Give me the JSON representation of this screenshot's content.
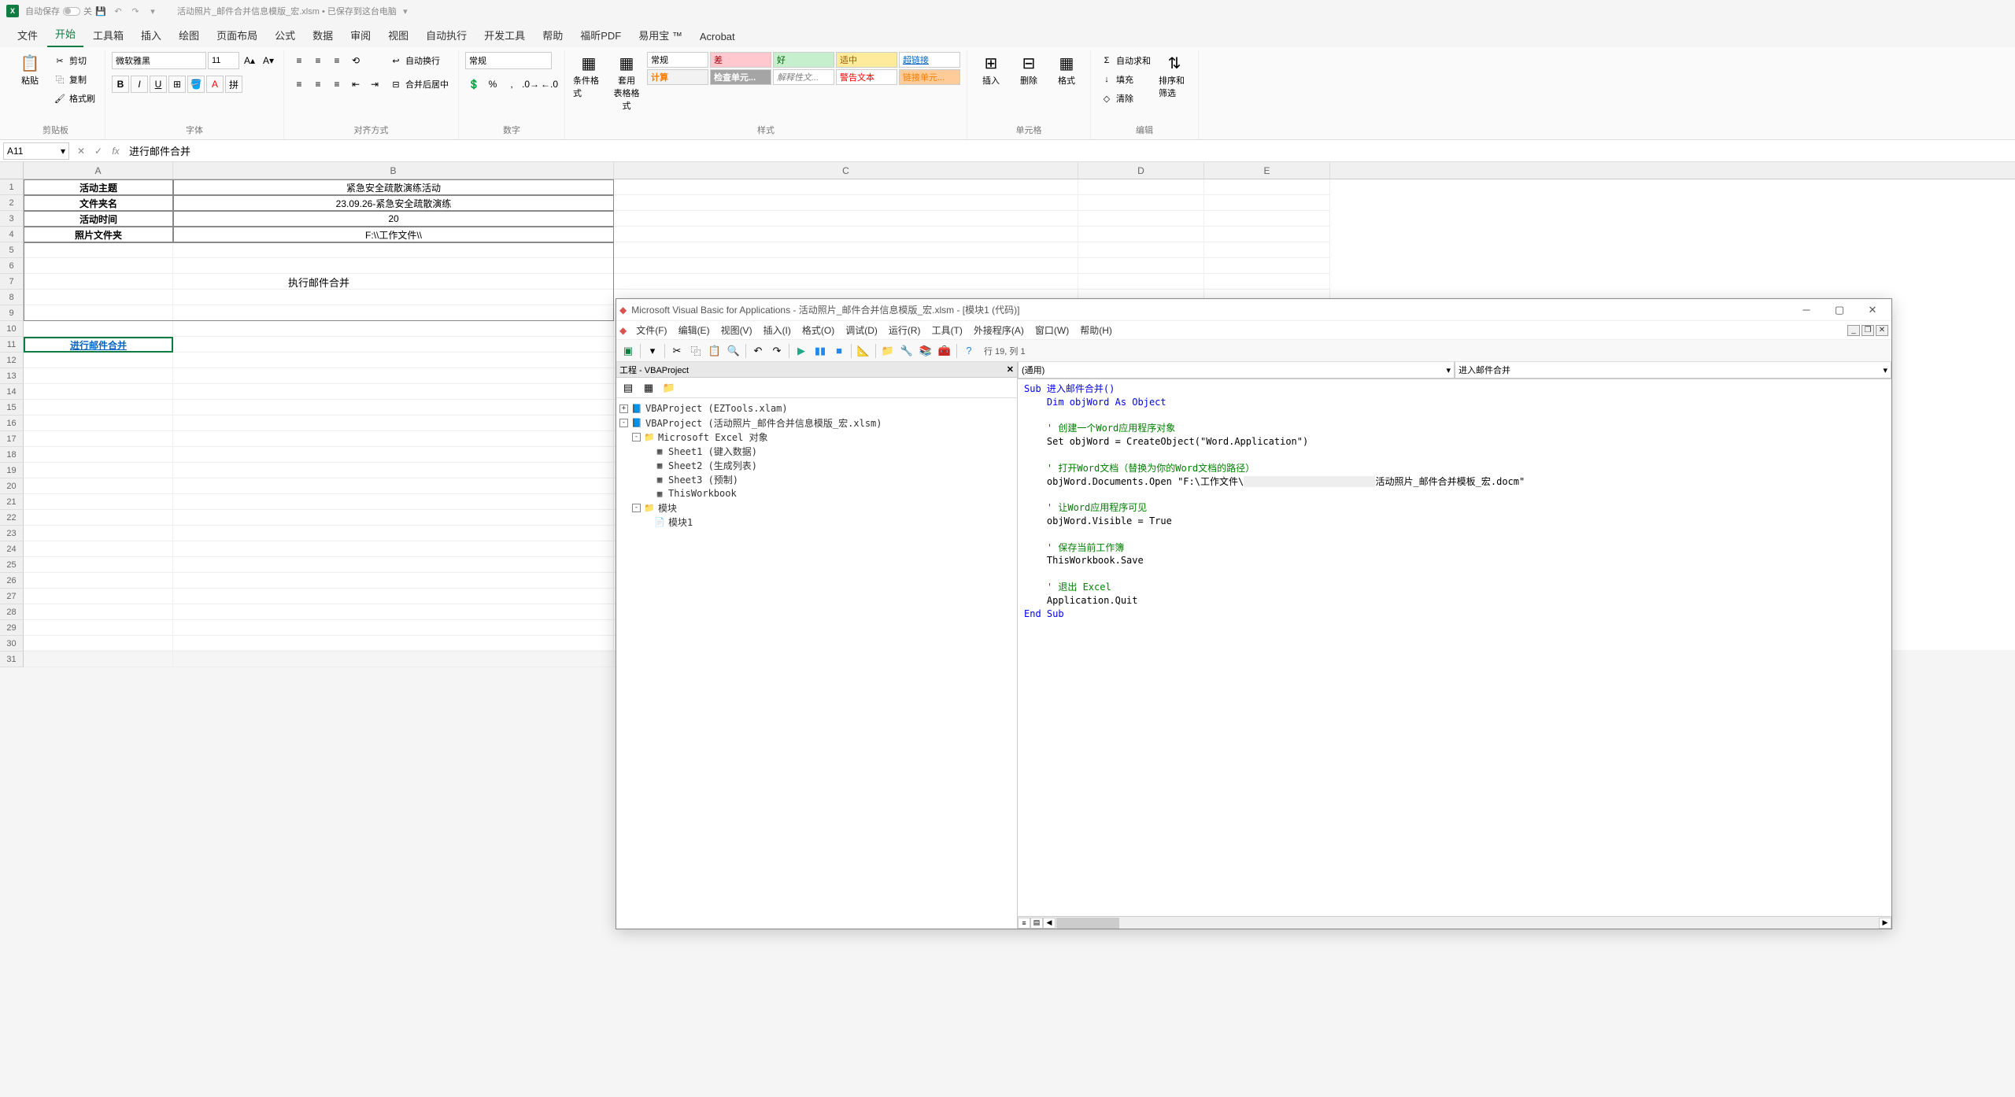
{
  "titlebar": {
    "autosave_label": "自动保存",
    "autosave_state": "关",
    "filename": "活动照片_邮件合并信息模版_宏.xlsm • 已保存到这台电脑"
  },
  "ribbon_tabs": [
    "文件",
    "开始",
    "工具箱",
    "插入",
    "绘图",
    "页面布局",
    "公式",
    "数据",
    "审阅",
    "视图",
    "自动执行",
    "开发工具",
    "帮助",
    "福昕PDF",
    "易用宝 ™",
    "Acrobat"
  ],
  "ribbon": {
    "clipboard": {
      "paste": "粘贴",
      "cut": "剪切",
      "copy": "复制",
      "format_painter": "格式刷",
      "label": "剪贴板"
    },
    "font": {
      "name": "微软雅黑",
      "size": "11",
      "label": "字体"
    },
    "alignment": {
      "wrap": "自动换行",
      "merge": "合并后居中",
      "label": "对齐方式"
    },
    "number": {
      "format": "常规",
      "label": "数字"
    },
    "styles": {
      "cond": "条件格式",
      "table": "套用\n表格格式",
      "normal": "常规",
      "bad": "差",
      "good": "好",
      "neutral": "适中",
      "calc": "计算",
      "check": "检查单元...",
      "explain": "解释性文...",
      "warn": "警告文本",
      "link": "超链接",
      "linkcell": "链接单元...",
      "label": "样式"
    },
    "cells": {
      "insert": "插入",
      "delete": "删除",
      "format": "格式",
      "label": "单元格"
    },
    "editing": {
      "sum": "自动求和",
      "fill": "填充",
      "clear": "清除",
      "sort": "排序和筛选",
      "label": "编辑"
    }
  },
  "formula_bar": {
    "cell_ref": "A11",
    "value": "进行邮件合并"
  },
  "columns": [
    "A",
    "B",
    "C",
    "D",
    "E"
  ],
  "sheet_data": {
    "r1": {
      "A": "活动主题",
      "B": "紧急安全疏散演练活动"
    },
    "r2": {
      "A": "文件夹名",
      "B": "23.09.26-紧急安全疏散演练"
    },
    "r3": {
      "A": "活动时间",
      "B": "20"
    },
    "r4": {
      "A": "照片文件夹",
      "B": "F:\\\\工作文件\\\\"
    },
    "r7": {
      "merged": "执行邮件合并"
    },
    "r11": {
      "A": "进行邮件合并"
    }
  },
  "vbe": {
    "title": "Microsoft Visual Basic for Applications - 活动照片_邮件合并信息模版_宏.xlsm - [模块1 (代码)]",
    "menus": [
      "文件(F)",
      "编辑(E)",
      "视图(V)",
      "插入(I)",
      "格式(O)",
      "调试(D)",
      "运行(R)",
      "工具(T)",
      "外接程序(A)",
      "窗口(W)",
      "帮助(H)"
    ],
    "status": "行 19, 列 1",
    "project_title": "工程 - VBAProject",
    "tree": {
      "p1": "VBAProject (EZTools.xlam)",
      "p2": "VBAProject (活动照片_邮件合并信息模版_宏.xlsm)",
      "folder1": "Microsoft Excel 对象",
      "s1": "Sheet1 (键入数据)",
      "s2": "Sheet2 (生成列表)",
      "s3": "Sheet3 (预制)",
      "wb": "ThisWorkbook",
      "folder2": "模块",
      "m1": "模块1"
    },
    "dd_left": "(通用)",
    "dd_right": "进入邮件合并",
    "code": {
      "l1": "Sub 进入邮件合并()",
      "l2": "    Dim objWord As Object",
      "l3": "",
      "l4": "    ' 创建一个Word应用程序对象",
      "l5": "    Set objWord = CreateObject(\"Word.Application\")",
      "l6": "",
      "l7": "    ' 打开Word文档（替换为你的Word文档的路径）",
      "l8a": "    objWord.Documents.Open \"F:\\工作文件\\",
      "l8b": "活动照片_邮件合并模板_宏.docm\"",
      "l9": "",
      "l10": "    ' 让Word应用程序可见",
      "l11": "    objWord.Visible = True",
      "l12": "",
      "l13": "    ' 保存当前工作簿",
      "l14": "    ThisWorkbook.Save",
      "l15": "",
      "l16": "    ' 退出 Excel",
      "l17": "    Application.Quit",
      "l18": "End Sub"
    }
  }
}
